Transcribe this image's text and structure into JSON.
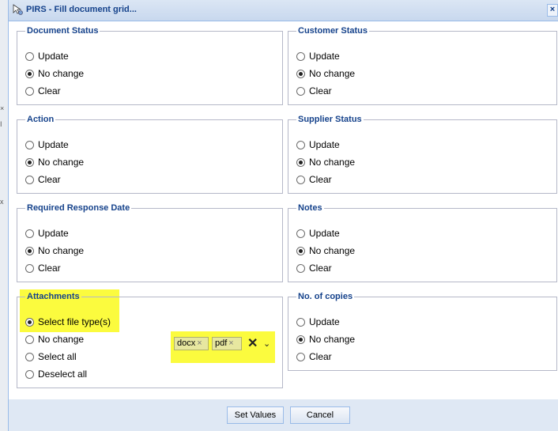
{
  "window": {
    "title": "PIRS - Fill document grid...",
    "close_symbol": "×",
    "title_icon": "cursor-settings-icon"
  },
  "sections": {
    "document_status": {
      "legend": "Document Status",
      "options": [
        "Update",
        "No change",
        "Clear"
      ],
      "selected": "No change"
    },
    "customer_status": {
      "legend": "Customer Status",
      "options": [
        "Update",
        "No change",
        "Clear"
      ],
      "selected": "No change"
    },
    "action": {
      "legend": "Action",
      "options": [
        "Update",
        "No change",
        "Clear"
      ],
      "selected": "No change"
    },
    "supplier_status": {
      "legend": "Supplier Status",
      "options": [
        "Update",
        "No change",
        "Clear"
      ],
      "selected": "No change"
    },
    "required_response_date": {
      "legend": "Required Response Date",
      "options": [
        "Update",
        "No change",
        "Clear"
      ],
      "selected": "No change"
    },
    "notes": {
      "legend": "Notes",
      "options": [
        "Update",
        "No change",
        "Clear"
      ],
      "selected": "No change"
    },
    "attachments": {
      "legend": "Attachments",
      "options": [
        "Select file type(s)",
        "No change",
        "Select all",
        "Deselect all"
      ],
      "selected": "Select file type(s)",
      "file_types": [
        "docx",
        "pdf"
      ],
      "tag_remove_symbol": "×",
      "clear_symbol": "✕",
      "dropdown_symbol": "⌄"
    },
    "no_of_copies": {
      "legend": "No. of copies",
      "options": [
        "Update",
        "No change",
        "Clear"
      ],
      "selected": "No change"
    }
  },
  "footer": {
    "set_values_label": "Set Values",
    "cancel_label": "Cancel"
  },
  "colors": {
    "legend_text": "#15428b",
    "highlight": "#fbfb3e",
    "window_frame": "#dfe8f4"
  }
}
